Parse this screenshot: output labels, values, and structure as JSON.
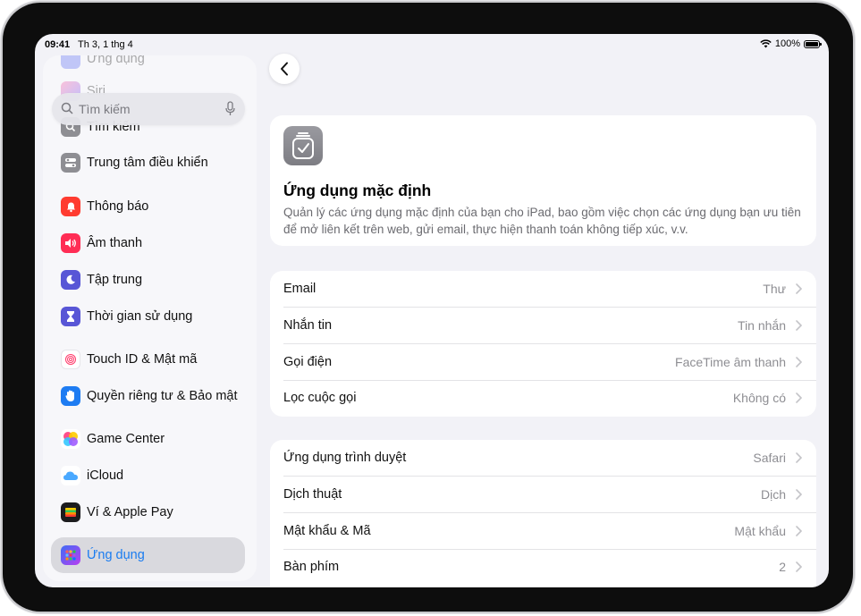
{
  "status_bar": {
    "time": "09:41",
    "date": "Th 3, 1 thg 4",
    "battery": "100%"
  },
  "sidebar": {
    "search_placeholder": "Tìm kiếm",
    "items": [
      {
        "label": "Ứng dụng",
        "icon": "apps-grid-icon",
        "color": "#5b6cf0"
      },
      {
        "label": "Siri",
        "icon": "siri-icon",
        "color": "#c060c0"
      },
      {
        "label": "Tìm kiếm",
        "icon": "search-icon",
        "color": "#8e8e93"
      },
      {
        "label": "Trung tâm điều khiển",
        "icon": "control-center-icon",
        "color": "#8e8e93"
      },
      {
        "label": "Thông báo",
        "icon": "bell-icon",
        "color": "#ff3b30"
      },
      {
        "label": "Âm thanh",
        "icon": "speaker-icon",
        "color": "#ff2d55"
      },
      {
        "label": "Tập trung",
        "icon": "moon-icon",
        "color": "#5856d6"
      },
      {
        "label": "Thời gian sử dụng",
        "icon": "hourglass-icon",
        "color": "#5856d6"
      },
      {
        "label": "Touch ID & Mật mã",
        "icon": "fingerprint-icon",
        "color": "#ffffff"
      },
      {
        "label": "Quyền riêng tư & Bảo mật",
        "icon": "hand-icon",
        "color": "#1e7cf2"
      },
      {
        "label": "Game Center",
        "icon": "game-center-icon",
        "color": "#ffffff"
      },
      {
        "label": "iCloud",
        "icon": "cloud-icon",
        "color": "#ffffff"
      },
      {
        "label": "Ví & Apple Pay",
        "icon": "wallet-icon",
        "color": "#1c1c1e"
      },
      {
        "label": "Ứng dụng",
        "icon": "apps-grid-icon",
        "color": "#5b6cf0"
      }
    ]
  },
  "header": {
    "title": "Ứng dụng mặc định",
    "description": "Quản lý các ứng dụng mặc định của bạn cho iPad, bao gồm việc chọn các ứng dụng bạn ưu tiên để mở liên kết trên web, gửi email, thực hiện thanh toán không tiếp xúc, v.v."
  },
  "group1": [
    {
      "label": "Email",
      "value": "Thư"
    },
    {
      "label": "Nhắn tin",
      "value": "Tin nhắn"
    },
    {
      "label": "Gọi điện",
      "value": "FaceTime âm thanh"
    },
    {
      "label": "Lọc cuộc gọi",
      "value": "Không có"
    }
  ],
  "group2": [
    {
      "label": "Ứng dụng trình duyệt",
      "value": "Safari"
    },
    {
      "label": "Dịch thuật",
      "value": "Dịch"
    },
    {
      "label": "Mật khẩu & Mã",
      "value": "Mật khẩu"
    },
    {
      "label": "Bàn phím",
      "value": "2"
    }
  ]
}
